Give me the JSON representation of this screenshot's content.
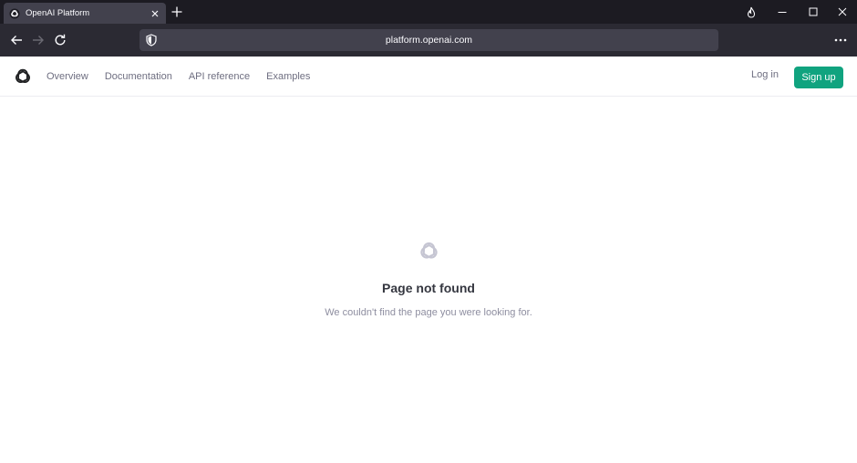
{
  "browser": {
    "tab": {
      "title": "OpenAI Platform"
    },
    "url": "platform.openai.com",
    "icons": [
      "openai-favicon",
      "close-icon",
      "plus-icon",
      "fire-icon",
      "minimize-icon",
      "maximize-icon",
      "close-window-icon",
      "back-arrow-icon",
      "forward-arrow-icon",
      "reload-icon",
      "shield-icon",
      "more-dots-icon"
    ]
  },
  "header": {
    "nav": [
      "Overview",
      "Documentation",
      "API reference",
      "Examples"
    ],
    "login_label": "Log in",
    "signup_label": "Sign up",
    "colors": {
      "accent": "#10a37f",
      "nav_text": "#6e6e80"
    }
  },
  "main": {
    "title": "Page not found",
    "message": "We couldn't find the page you were looking for."
  }
}
